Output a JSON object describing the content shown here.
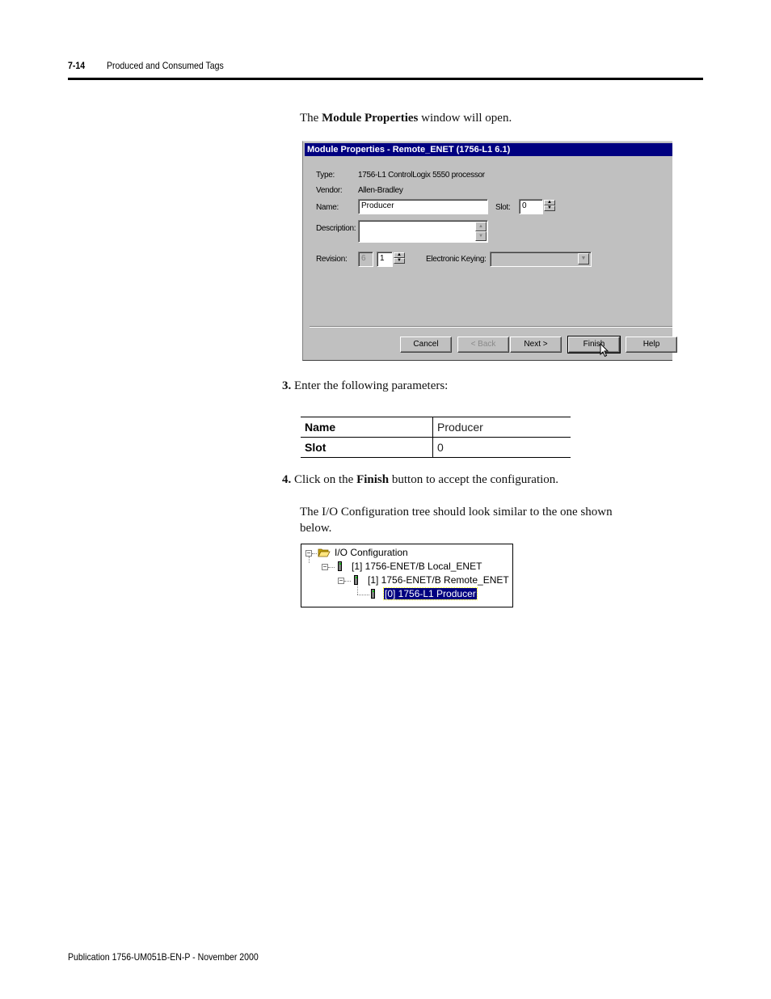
{
  "header": {
    "page_number": "7-14",
    "running_head": "Produced and Consumed Tags"
  },
  "intro": {
    "prefix": "The ",
    "bold": "Module Properties",
    "suffix": " window will open."
  },
  "dialog": {
    "title": "Module Properties - Remote_ENET (1756-L1 6.1)",
    "type_label": "Type:",
    "type_value": "1756-L1 ControlLogix 5550 processor",
    "vendor_label": "Vendor:",
    "vendor_value": "Allen-Bradley",
    "name_label": "Name:",
    "name_value": "Producer",
    "slot_label": "Slot:",
    "slot_value": "0",
    "description_label": "Description:",
    "description_value": "",
    "revision_label": "Revision:",
    "revision_major": "6",
    "revision_minor": "1",
    "keying_label": "Electronic Keying:",
    "keying_value": "",
    "buttons": {
      "cancel": "Cancel",
      "back": "< Back",
      "next": "Next >",
      "finish": "Finish",
      "help": "Help"
    },
    "colors": {
      "titlebar": "#000080",
      "face": "#c0c0c0"
    }
  },
  "step3": {
    "number": "3.",
    "text": "Enter the following parameters:"
  },
  "parameters": [
    {
      "key": "Name",
      "value": "Producer"
    },
    {
      "key": "Slot",
      "value": "0"
    }
  ],
  "step4": {
    "number": "4.",
    "prefix": "Click on the ",
    "bold": "Finish",
    "suffix": " button to accept the configuration."
  },
  "tree_intro": {
    "line1": "The I/O Configuration tree should look similar to the one shown",
    "line2": "below."
  },
  "tree": {
    "root": "I/O Configuration",
    "nodes": [
      {
        "label": "[1] 1756-ENET/B Local_ENET"
      },
      {
        "label": "[1] 1756-ENET/B Remote_ENET"
      },
      {
        "label": "[0] 1756-L1 Producer",
        "selected": true
      }
    ]
  },
  "footer": {
    "publication": "Publication 1756-UM051B-EN-P - November 2000"
  }
}
